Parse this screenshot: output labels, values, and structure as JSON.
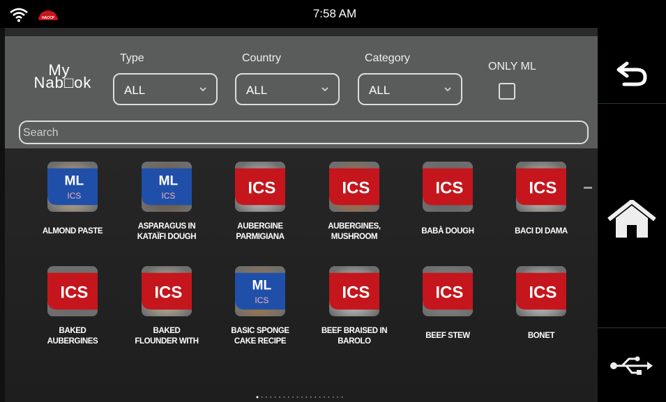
{
  "status": {
    "time": "7:58 AM",
    "haccp_label": "HACCP"
  },
  "logo": {
    "line1": "My",
    "line2": "Nab□ok"
  },
  "filters": {
    "type_label": "Type",
    "type_value": "ALL",
    "country_label": "Country",
    "country_value": "ALL",
    "category_label": "Category",
    "category_value": "ALL",
    "only_ml_label": "ONLY ML",
    "only_ml_checked": false
  },
  "search": {
    "placeholder": "Search",
    "value": ""
  },
  "recipes": [
    {
      "line1": "ALMOND PASTE",
      "line2": "",
      "badge": "ML ICS",
      "colors": [
        "#b7623a",
        "#e7c79a"
      ]
    },
    {
      "line1": "ASPARAGUS IN",
      "line2": "KATAÏFI DOUGH",
      "badge": "ML ICS",
      "colors": [
        "#d6c28a",
        "#6b4a2a"
      ]
    },
    {
      "line1": "AUBERGINE",
      "line2": "PARMIGIANA",
      "badge": "ICS",
      "colors": [
        "#a0321e",
        "#f1f1f1"
      ]
    },
    {
      "line1": "AUBERGINES,",
      "line2": "MUSHROOM",
      "badge": "ICS",
      "colors": [
        "#5a3b25",
        "#c96a2a"
      ]
    },
    {
      "line1": "BABÀ DOUGH",
      "line2": "",
      "badge": "ICS",
      "colors": [
        "#d9722e",
        "#5c5c5c"
      ]
    },
    {
      "line1": "BACI DI DAMA",
      "line2": "",
      "badge": "ICS",
      "colors": [
        "#d7a45e",
        "#f4e9d6"
      ]
    },
    {
      "line1": "BAKED",
      "line2": "AUBERGINES",
      "badge": "ICS",
      "colors": [
        "#b8472a",
        "#6a6a6a"
      ]
    },
    {
      "line1": "BAKED",
      "line2": "FLOUNDER WITH",
      "badge": "ICS",
      "colors": [
        "#6a5636",
        "#e6d6b0"
      ]
    },
    {
      "line1": "BASIC SPONGE",
      "line2": "CAKE RECIPE",
      "badge": "ML ICS",
      "colors": [
        "#f0c24a",
        "#c27e2b"
      ]
    },
    {
      "line1": "BEEF BRAISED IN",
      "line2": "BAROLO",
      "badge": "ICS",
      "colors": [
        "#5a2d1c",
        "#f2f2f2"
      ]
    },
    {
      "line1": "BEEF STEW",
      "line2": "",
      "badge": "ICS",
      "colors": [
        "#4a2a1e",
        "#8a8a8a"
      ]
    },
    {
      "line1": "BONET",
      "line2": "",
      "badge": "ICS",
      "colors": [
        "#8a4a22",
        "#f6f6f6"
      ]
    }
  ],
  "pager": {
    "current_page": 1,
    "total_pages": 20
  },
  "nav": {
    "back": "back-arrow-icon",
    "home": "home-icon",
    "usb": "usb-icon"
  },
  "colors": {
    "badge_red": "#c4161c",
    "badge_blue": "#1f4fa8",
    "filter_bg": "#5a5c5c"
  }
}
